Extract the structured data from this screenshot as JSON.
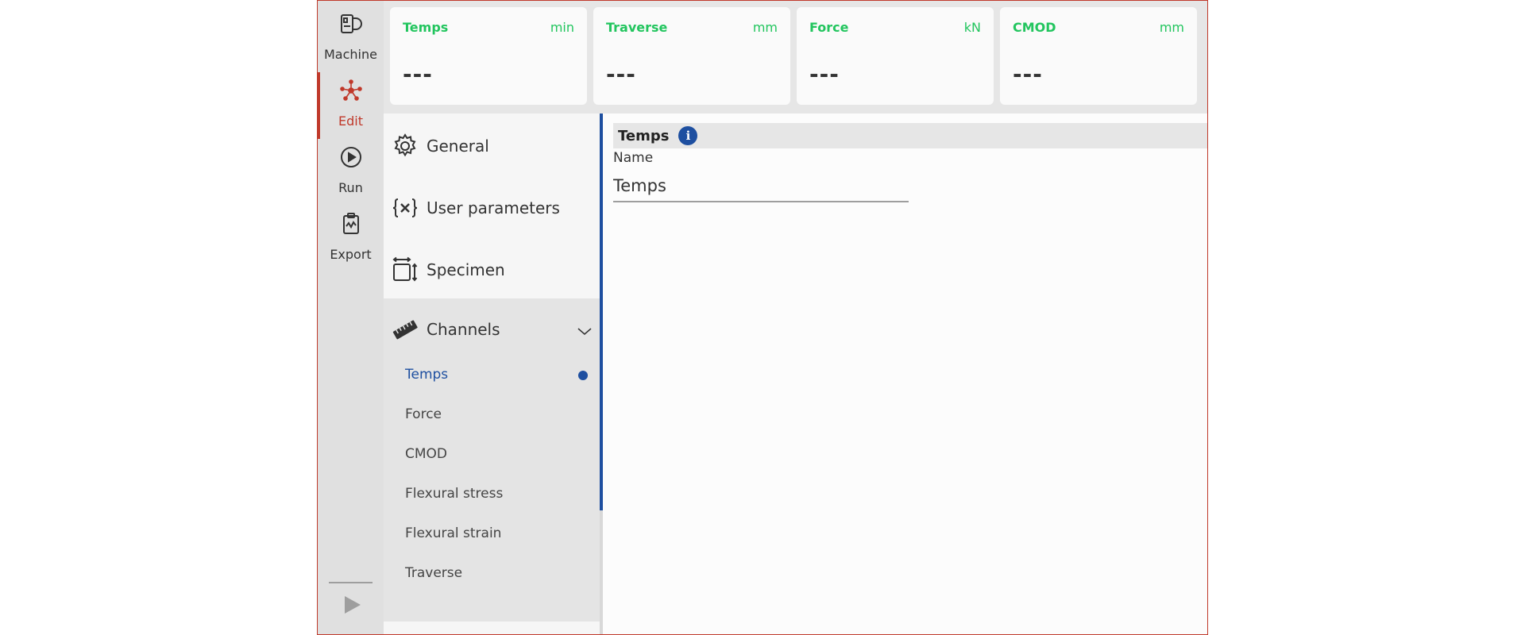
{
  "rail": {
    "items": [
      {
        "label": "Machine",
        "icon": "machine-icon"
      },
      {
        "label": "Edit",
        "icon": "network-icon",
        "active": true
      },
      {
        "label": "Run",
        "icon": "play-circle-icon"
      },
      {
        "label": "Export",
        "icon": "clipboard-icon"
      }
    ]
  },
  "readouts": [
    {
      "name": "Temps",
      "unit": "min",
      "value": "---"
    },
    {
      "name": "Traverse",
      "unit": "mm",
      "value": "---"
    },
    {
      "name": "Force",
      "unit": "kN",
      "value": "---"
    },
    {
      "name": "CMOD",
      "unit": "mm",
      "value": "---"
    }
  ],
  "menu": {
    "items": [
      {
        "label": "General",
        "icon": "gear-icon"
      },
      {
        "label": "User parameters",
        "icon": "variable-icon"
      },
      {
        "label": "Specimen",
        "icon": "specimen-dimensions-icon"
      },
      {
        "label": "Channels",
        "icon": "ruler-icon",
        "expanded": true
      }
    ],
    "channels": [
      {
        "label": "Temps",
        "active": true
      },
      {
        "label": "Force"
      },
      {
        "label": "CMOD"
      },
      {
        "label": "Flexural stress"
      },
      {
        "label": "Flexural strain"
      },
      {
        "label": "Traverse"
      }
    ]
  },
  "content": {
    "section_title": "Temps",
    "info_glyph": "i",
    "name_label": "Name",
    "name_value": "Temps"
  },
  "colors": {
    "accent_red": "#c0392b",
    "accent_blue": "#1e4fa0",
    "readout_green": "#22c55e"
  }
}
